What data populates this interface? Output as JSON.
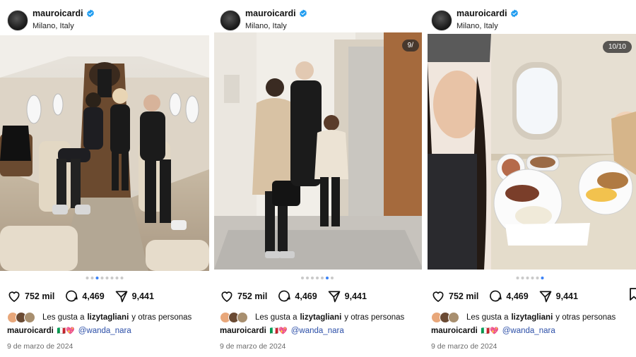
{
  "colors": {
    "accent": "#3b82f6",
    "verified": "#1d9bf0",
    "mention": "#2c4fa8",
    "date": "#6b6b6b"
  },
  "posts": [
    {
      "username": "mauroicardi",
      "location": "Milano, Italy",
      "counter": "",
      "actions": {
        "likes": "752 mil",
        "comments": "4,469",
        "shares": "9,441"
      },
      "liked_by": {
        "prefix": "Les gusta a",
        "user": "lizytagliani",
        "suffix": "y otras personas"
      },
      "caption": {
        "user": "mauroicardi",
        "emoji": "🇮🇹💖",
        "mention": "@wanda_nara"
      },
      "date": "9 de marzo de 2024",
      "icons": [
        "heart-icon",
        "comment-icon",
        "share-icon",
        "verified-icon"
      ]
    },
    {
      "username": "mauroicardi",
      "location": "Milano, Italy",
      "counter": "9/",
      "actions": {
        "likes": "752 mil",
        "comments": "4,469",
        "shares": "9,441"
      },
      "liked_by": {
        "prefix": "Les gusta a",
        "user": "lizytagliani",
        "suffix": "y otras personas"
      },
      "caption": {
        "user": "mauroicardi",
        "emoji": "🇮🇹💖",
        "mention": "@wanda_nara"
      },
      "date": "9 de marzo de 2024"
    },
    {
      "username": "mauroicardi",
      "location": "Milano, Italy",
      "counter": "10/10",
      "actions": {
        "likes": "752 mil",
        "comments": "4,469",
        "shares": "9,441"
      },
      "liked_by": {
        "prefix": "Les gusta a",
        "user": "lizytagliani",
        "suffix": "y otras personas"
      },
      "caption": {
        "user": "mauroicardi",
        "emoji": "🇮🇹💖",
        "mention": "@wanda_nara"
      },
      "date": "9 de marzo de 2024"
    }
  ]
}
